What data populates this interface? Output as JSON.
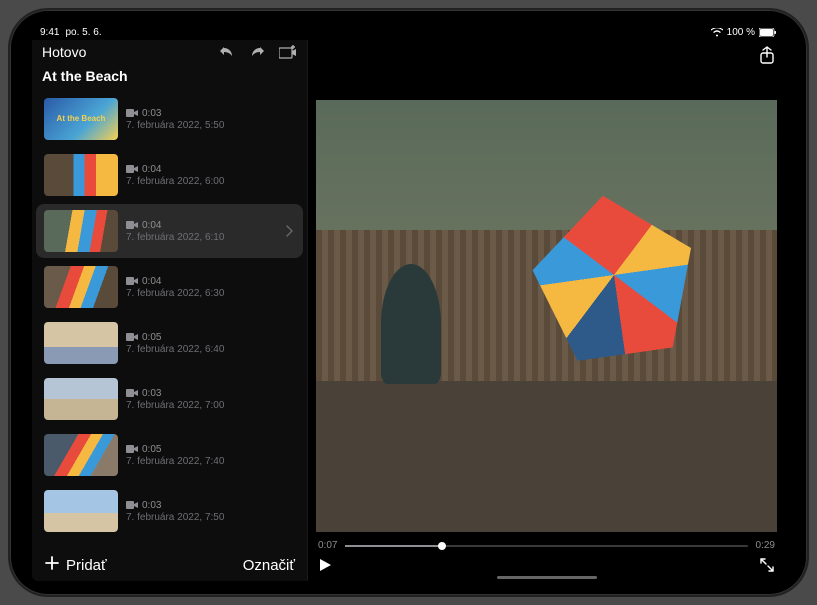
{
  "status": {
    "time": "9:41",
    "date": "po. 5. 6.",
    "battery": "100 %"
  },
  "header": {
    "done": "Hotovo"
  },
  "project": {
    "title": "At the Beach"
  },
  "clips": [
    {
      "thumb_label": "At the Beach",
      "thumb_class": "th-title",
      "icon": "video",
      "duration": "0:03",
      "date": "7. februára 2022, 5:50",
      "selected": false
    },
    {
      "thumb_label": "",
      "thumb_class": "th-kite1",
      "icon": "video",
      "duration": "0:04",
      "date": "7. februára 2022, 6:00",
      "selected": false
    },
    {
      "thumb_label": "",
      "thumb_class": "th-kite2",
      "icon": "video",
      "duration": "0:04",
      "date": "7. februára 2022, 6:10",
      "selected": true
    },
    {
      "thumb_label": "",
      "thumb_class": "th-kite3",
      "icon": "video",
      "duration": "0:04",
      "date": "7. februára 2022, 6:30",
      "selected": false
    },
    {
      "thumb_label": "",
      "thumb_class": "th-beach1",
      "icon": "video",
      "duration": "0:05",
      "date": "7. februára 2022, 6:40",
      "selected": false
    },
    {
      "thumb_label": "",
      "thumb_class": "th-beach2",
      "icon": "video",
      "duration": "0:03",
      "date": "7. februára 2022, 7:00",
      "selected": false
    },
    {
      "thumb_label": "",
      "thumb_class": "th-walk",
      "icon": "video",
      "duration": "0:05",
      "date": "7. februára 2022, 7:40",
      "selected": false
    },
    {
      "thumb_label": "",
      "thumb_class": "th-family",
      "icon": "video",
      "duration": "0:03",
      "date": "7. februára 2022, 7:50",
      "selected": false
    }
  ],
  "footer": {
    "add": "Pridať",
    "mark": "Označiť"
  },
  "player": {
    "current": "0:07",
    "total": "0:29",
    "progress_pct": 24
  }
}
